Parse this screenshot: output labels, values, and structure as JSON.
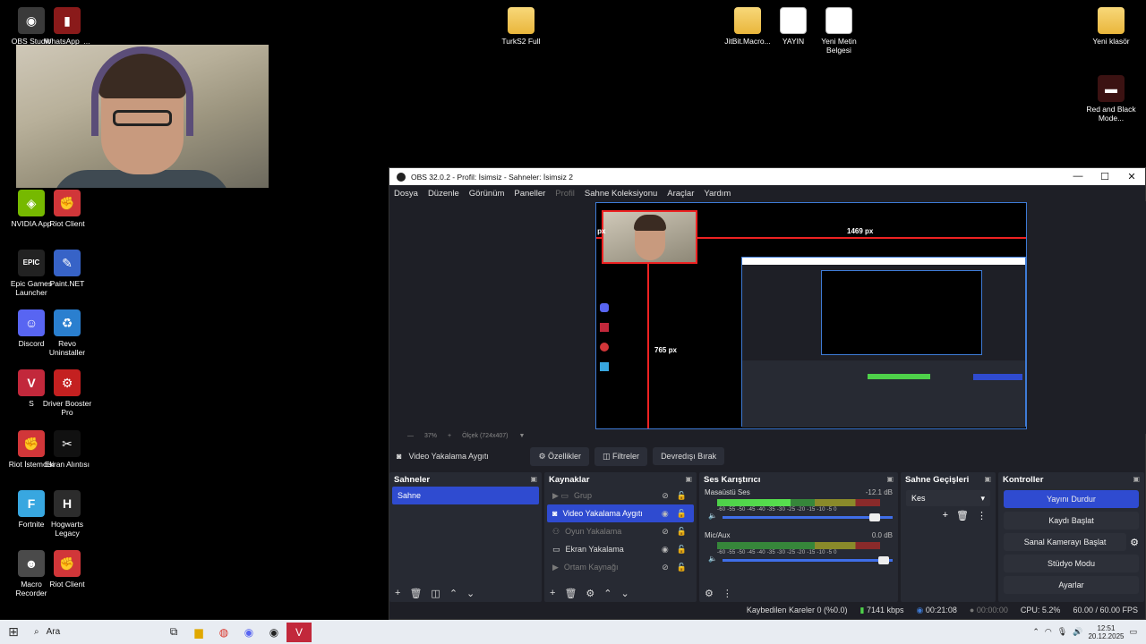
{
  "desktop": {
    "icons": [
      {
        "label": "OBS Studio",
        "color": "#3a3a3a",
        "glyph": "◉"
      },
      {
        "label": "WhatsApp_...",
        "color": "#8a1a1a",
        "glyph": "▮"
      },
      {
        "label": "TurkS2 Full",
        "color": "folder",
        "glyph": ""
      },
      {
        "label": "JitBit.Macro...",
        "color": "folder",
        "glyph": ""
      },
      {
        "label": "YAYIN",
        "color": "doc",
        "glyph": ""
      },
      {
        "label": "Yeni Metin Belgesi",
        "color": "doc",
        "glyph": ""
      },
      {
        "label": "Yeni klasör",
        "color": "folder",
        "glyph": ""
      },
      {
        "label": "Red and Black Mode...",
        "color": "#3b1212",
        "glyph": "▬"
      },
      {
        "label": "NVIDIA App",
        "color": "#76b900",
        "glyph": "◈"
      },
      {
        "label": "Riot Client",
        "color": "#d13639",
        "glyph": "✊"
      },
      {
        "label": "Epic Games Launcher",
        "color": "#222",
        "glyph": "EPIC"
      },
      {
        "label": "Paint.NET",
        "color": "#3763c7",
        "glyph": "✎"
      },
      {
        "label": "Discord",
        "color": "#5865f2",
        "glyph": "☺"
      },
      {
        "label": "Revo Uninstaller",
        "color": "#2a7fcf",
        "glyph": "♻"
      },
      {
        "label": "S",
        "color": "#c2283b",
        "glyph": "V"
      },
      {
        "label": "Driver Booster Pro",
        "color": "#c42020",
        "glyph": "⚙"
      },
      {
        "label": "Riot İstemcisi",
        "color": "#d13639",
        "glyph": "✊"
      },
      {
        "label": "Ekran Alıntısı",
        "color": "#111",
        "glyph": "✂"
      },
      {
        "label": "Fortnite",
        "color": "#38a7e0",
        "glyph": "F"
      },
      {
        "label": "Hogwarts Legacy",
        "color": "#2c2c2c",
        "glyph": "H"
      },
      {
        "label": "Macro Recorder",
        "color": "#4a4a4a",
        "glyph": "☻"
      },
      {
        "label": "Riot Client",
        "color": "#d13639",
        "glyph": "✊"
      }
    ]
  },
  "obs": {
    "title": "OBS 32.0.2 - Profil: İsimsiz - Sahneler: İsimsiz 2",
    "menu": [
      "Dosya",
      "Düzenle",
      "Görünüm",
      "Paneller",
      "Profil",
      "Sahne Koleksiyonu",
      "Araçlar",
      "Yardım"
    ],
    "preview": {
      "px_left": "27 px",
      "px_right": "1469 px",
      "px_bottom": "765 px"
    },
    "zoom": {
      "percent": "37%",
      "plus": "+",
      "scale": "Ölçek (724x407)"
    },
    "source_bar": {
      "name": "Video Yakalama Aygıtı",
      "props": "Özellikler",
      "filters": "Filtreler",
      "deactivate": "Devredışı Bırak"
    },
    "scenes": {
      "title": "Sahneler",
      "items": [
        "Sahne"
      ]
    },
    "sources": {
      "title": "Kaynaklar",
      "items": [
        {
          "name": "Grup",
          "dim": true,
          "icon": "▶ ▭"
        },
        {
          "name": "Video Yakalama Aygıtı",
          "sel": true,
          "icon": "◙"
        },
        {
          "name": "Oyun Yakalama",
          "dim": true,
          "icon": "⚇"
        },
        {
          "name": "Ekran Yakalama",
          "dim": false,
          "icon": "▭"
        },
        {
          "name": "Ortam Kaynağı",
          "dim": true,
          "icon": "▶"
        }
      ]
    },
    "mixer": {
      "title": "Ses Karıştırıcı",
      "channels": [
        {
          "name": "Masaüstü Ses",
          "db": "-12.1 dB",
          "level": 0.45,
          "volume": 0.92
        },
        {
          "name": "Mic/Aux",
          "db": "0.0 dB",
          "level": 0.0,
          "volume": 0.98
        }
      ],
      "scale": "-60 -55 -50 -45 -40 -35 -30 -25 -20 -15 -10 -5 0"
    },
    "transitions": {
      "title": "Sahne Geçişleri",
      "value": "Kes"
    },
    "controls": {
      "title": "Kontroller",
      "buttons": [
        "Yayını Durdur",
        "Kaydı Başlat",
        "Sanal Kamerayı Başlat",
        "Stüdyo Modu",
        "Ayarlar"
      ]
    },
    "status": {
      "dropped": "Kaybedilen Kareler 0 (%0.0)",
      "bitrate": "7141 kbps",
      "stream_time": "00:21:08",
      "rec_time": "00:00:00",
      "cpu": "CPU: 5.2%",
      "fps": "60.00 / 60.00 FPS"
    }
  },
  "taskbar": {
    "search": "Ara",
    "time": "12:51",
    "date": "20.12.2025"
  }
}
